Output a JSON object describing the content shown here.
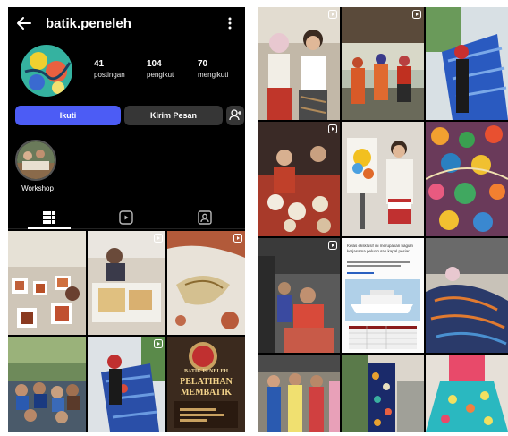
{
  "profile": {
    "username": "batik.peneleh",
    "stats": [
      {
        "count": "41",
        "label": "postingan"
      },
      {
        "count": "104",
        "label": "pengikut"
      },
      {
        "count": "70",
        "label": "mengikuti"
      }
    ],
    "follow_label": "Ikuti",
    "message_label": "Kirim Pesan",
    "highlight_label": "Workshop"
  },
  "posts": {
    "poster_title_1": "PELATIHAN",
    "poster_title_2": "MEMBATIK",
    "poster_brand": "BATIK PENELEH",
    "cruise_doc_text": "Kelas eksklusif ini merupakan bagian kerjasama peluncuran kapal pesiar..."
  },
  "colors": {
    "follow_blue": "#4c5cf5",
    "secondary_button": "#363636",
    "background": "#000000"
  },
  "icons": [
    "back-arrow-icon",
    "more-vert-icon",
    "add-user-icon",
    "grid-icon",
    "reels-icon",
    "tagged-icon",
    "reel-badge-icon"
  ]
}
